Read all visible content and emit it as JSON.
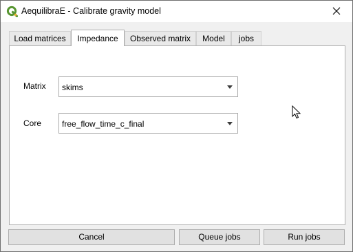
{
  "window": {
    "title": "AequilibraE - Calibrate gravity model",
    "app_icon": "qgis-logo-icon",
    "close_icon": "close-icon"
  },
  "tabs": [
    {
      "label": "Load matrices",
      "active": false
    },
    {
      "label": "Impedance",
      "active": true
    },
    {
      "label": "Observed matrix",
      "active": false
    },
    {
      "label": "Model",
      "active": false
    },
    {
      "label": "jobs",
      "active": false
    }
  ],
  "impedance": {
    "matrix_label": "Matrix",
    "matrix_value": "skims",
    "core_label": "Core",
    "core_value": "free_flow_time_c_final"
  },
  "buttons": {
    "cancel": "Cancel",
    "queue_jobs": "Queue jobs",
    "run_jobs": "Run jobs"
  },
  "colors": {
    "qgis_green": "#589632",
    "qgis_yellow": "#eeb034"
  }
}
